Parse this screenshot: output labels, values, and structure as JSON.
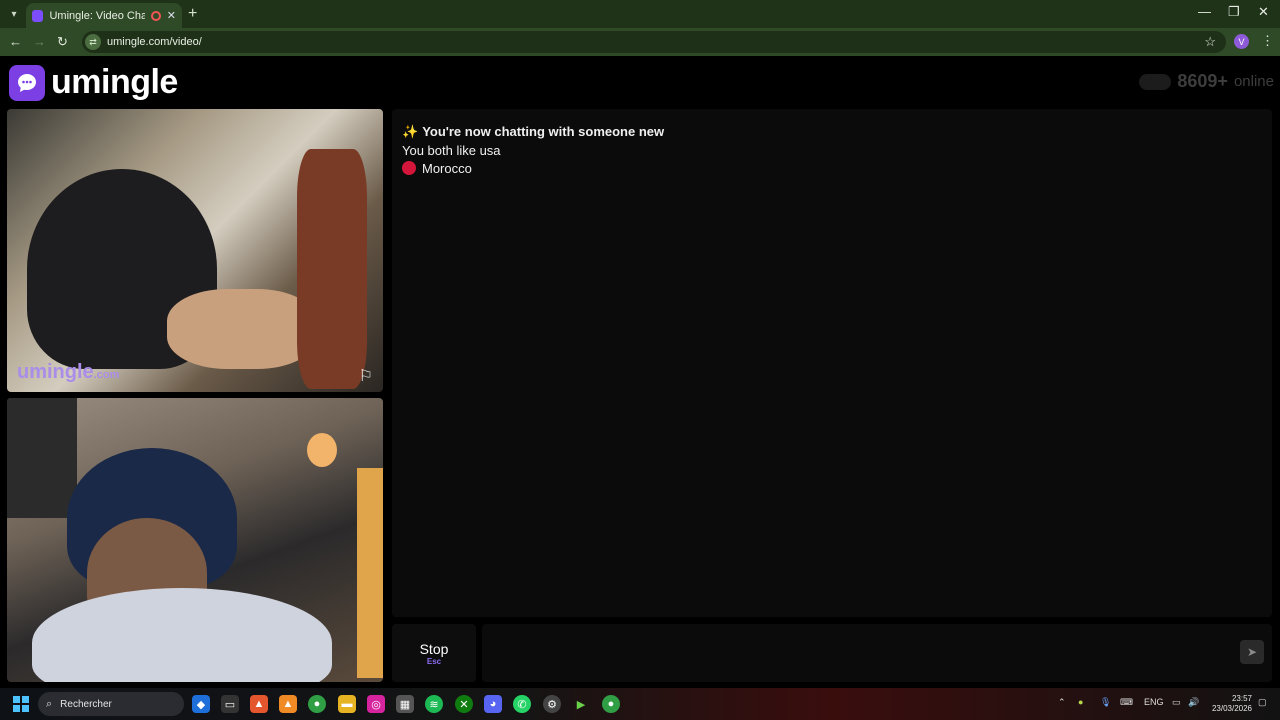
{
  "browser": {
    "tab_title": "Umingle: Video Chat with S",
    "url": "umingle.com/video/",
    "profile_initial": "V",
    "win_minimize": "—",
    "win_restore": "❐",
    "win_close": "✕"
  },
  "header": {
    "logo_text": "umingle",
    "online_count": "8609+",
    "online_label": "online"
  },
  "videos": {
    "stranger_watermark": "umingle",
    "stranger_watermark_suffix": ".com"
  },
  "chat": {
    "messages": [
      {
        "text": "You're now chatting with someone new",
        "icon": "sparkles-icon"
      },
      {
        "text": "You both like usa"
      },
      {
        "text": "Morocco",
        "icon": "flag-morocco"
      }
    ]
  },
  "controls": {
    "stop_label": "Stop",
    "stop_key": "Esc",
    "message_placeholder": ""
  },
  "taskbar": {
    "search_label": "Rechercher",
    "language": "ENG",
    "time": "23:57",
    "date": "23/03/2026"
  },
  "colors": {
    "brand": "#7b3fe4",
    "chrome_dark": "#1f3319",
    "chrome_bar": "#2f4a27",
    "country_dot": "#d5163b"
  }
}
